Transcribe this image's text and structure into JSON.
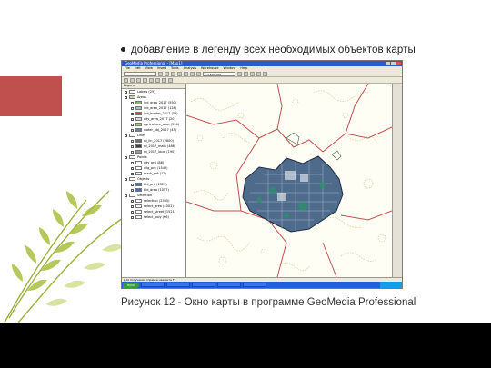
{
  "slide": {
    "bullet_text": "добавление в легенду всех необходимых объектов карты",
    "caption": "Рисунок 12 - Окно карты в программе GeoMedia Professional"
  },
  "app": {
    "title": "GeoMedia Professional - [Map1]",
    "menu": [
      "File",
      "Edit",
      "View",
      "Insert",
      "Tools",
      "Analysis",
      "Warehouse",
      "Window",
      "Help"
    ],
    "scale_combo": "1:2 500 000",
    "legend_title": "Legend",
    "legend_items": [
      {
        "indent": 0,
        "label": "Labels (25)",
        "color": "#ffffff"
      },
      {
        "indent": 0,
        "label": "Areas",
        "color": "#c7d9a5"
      },
      {
        "indent": 1,
        "label": "lnd_area_2017 (550)",
        "color": "#8fb36b"
      },
      {
        "indent": 1,
        "label": "lnd_area_2017 (128)",
        "color": "#9ec3d6"
      },
      {
        "indent": 1,
        "label": "lnd_border_2017 (56)",
        "color": "#c0504d"
      },
      {
        "indent": 1,
        "label": "city_area_2017 (20)",
        "color": "#d9d9d9"
      },
      {
        "indent": 1,
        "label": "agriculture_area (314)",
        "color": "#b8cc82"
      },
      {
        "indent": 1,
        "label": "water_obj_2017 (43)",
        "color": "#5b86b8"
      },
      {
        "indent": 0,
        "label": "Lines",
        "color": "#ffffff"
      },
      {
        "indent": 1,
        "label": "rd_lin_2017 (2800)",
        "color": "#707070"
      },
      {
        "indent": 1,
        "label": "rd_2017_main (486)",
        "color": "#404040"
      },
      {
        "indent": 1,
        "label": "rd_2017_local (190)",
        "color": "#9a9a9a"
      },
      {
        "indent": 0,
        "label": "Points",
        "color": "#ffffff"
      },
      {
        "indent": 1,
        "label": "city_pnt (88)",
        "color": "#ffffff"
      },
      {
        "indent": 1,
        "label": "vilg_pnt (1542)",
        "color": "#ffffff"
      },
      {
        "indent": 1,
        "label": "mark_pnt (12)",
        "color": "#ffffff"
      },
      {
        "indent": 0,
        "label": "Objects",
        "color": "#ffffff"
      },
      {
        "indent": 1,
        "label": "bld_pnt (1327)",
        "color": "#4a6fa5"
      },
      {
        "indent": 1,
        "label": "bld_area (1057)",
        "color": "#4a6fa5"
      },
      {
        "indent": 0,
        "label": "Selection",
        "color": "#ffffff"
      },
      {
        "indent": 1,
        "label": "selection (2365)",
        "color": "#ffffff"
      },
      {
        "indent": 1,
        "label": "select_area (4001)",
        "color": "#ffffff"
      },
      {
        "indent": 1,
        "label": "select_street (1521)",
        "color": "#ffffff"
      },
      {
        "indent": 1,
        "label": "select_poly (66)",
        "color": "#ffffff"
      }
    ],
    "status_text": "Для получения справки нажмите F1",
    "taskbar_start": "пуск",
    "colors": {
      "title_bar": "#2a5cc8",
      "map_background": "#fffef4",
      "boundary_red": "#c0504d",
      "region_fill": "#4e6b8c",
      "slide_accent": "#c0504d"
    }
  }
}
